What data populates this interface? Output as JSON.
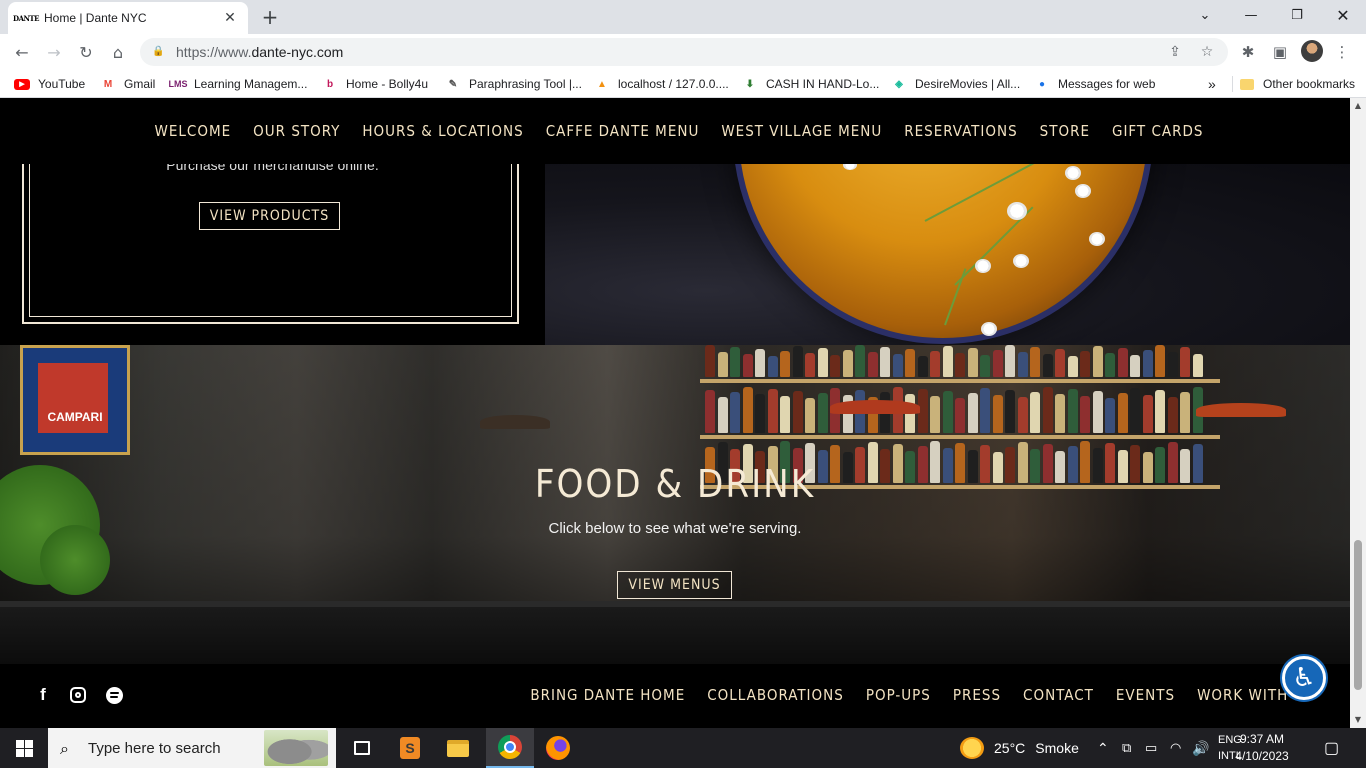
{
  "browser": {
    "tab_title": "Home | Dante NYC",
    "favicon_text": "DANTE",
    "url_scheme": "https://www.",
    "url_host": "dante-nyc.com",
    "bookmarks": [
      {
        "label": "YouTube",
        "icon": "youtube-icon",
        "color": "#ff0000"
      },
      {
        "label": "Gmail",
        "icon": "gmail-icon",
        "color": "#ea4335"
      },
      {
        "label": "Learning Managem...",
        "icon": "lms-icon",
        "color": "#7a1f6e"
      },
      {
        "label": "Home - Bolly4u",
        "icon": "bolly4u-icon",
        "color": "#c2185b"
      },
      {
        "label": "Paraphrasing Tool |...",
        "icon": "paraphrasing-icon",
        "color": "#555555"
      },
      {
        "label": "localhost / 127.0.0....",
        "icon": "phpmyadmin-icon",
        "color": "#f29111"
      },
      {
        "label": "CASH IN HAND-Lo...",
        "icon": "cash-icon",
        "color": "#2e7d32"
      },
      {
        "label": "DesireMovies | All...",
        "icon": "desiremovies-icon",
        "color": "#1abc9c"
      },
      {
        "label": "Messages for web",
        "icon": "messages-icon",
        "color": "#1a73e8"
      }
    ],
    "more_bookmarks": "»",
    "other_bookmarks": "Other bookmarks"
  },
  "site": {
    "nav": [
      "WELCOME",
      "OUR STORY",
      "HOURS & LOCATIONS",
      "CAFFE DANTE MENU",
      "WEST VILLAGE MENU",
      "RESERVATIONS",
      "STORE",
      "GIFT CARDS"
    ],
    "store_desc": "Purchase our merchandise online.",
    "store_button": "VIEW PRODUCTS",
    "food_title": "FOOD & DRINK",
    "food_subtitle": "Click below to see what we're serving.",
    "food_button": "VIEW MENUS",
    "poster_text": "CAMPARI",
    "footer_nav": [
      "BRING DANTE HOME",
      "COLLABORATIONS",
      "POP-UPS",
      "PRESS",
      "CONTACT",
      "EVENTS",
      "WORK WITH US"
    ],
    "social": [
      "facebook-icon",
      "instagram-icon",
      "spotify-icon"
    ],
    "accent_color": "#f3e3c3"
  },
  "taskbar": {
    "search_placeholder": "Type here to search",
    "weather_temp": "25°C",
    "weather_desc": "Smoke",
    "lang_top": "ENG",
    "lang_bottom": "INTL",
    "time": "9:37 AM",
    "date": "4/10/2023"
  }
}
